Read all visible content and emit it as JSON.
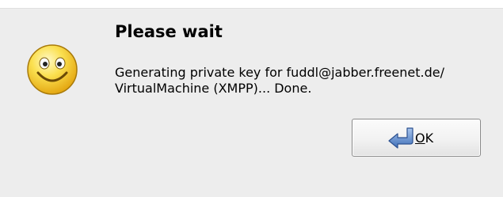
{
  "dialog": {
    "title": "Please wait",
    "message_lines": [
      "Generating private key for fuddl@jabber.freenet.de/",
      "VirtualMachine (XMPP)... Done."
    ],
    "icon": "smiley-face-icon",
    "ok_button": {
      "mnemonic": "O",
      "rest": "K",
      "icon": "return-arrow-icon"
    }
  },
  "colors": {
    "dialog_background": "#ededed",
    "smiley_yellow": "#f6d21a",
    "arrow_blue": "#5f8fd0"
  }
}
